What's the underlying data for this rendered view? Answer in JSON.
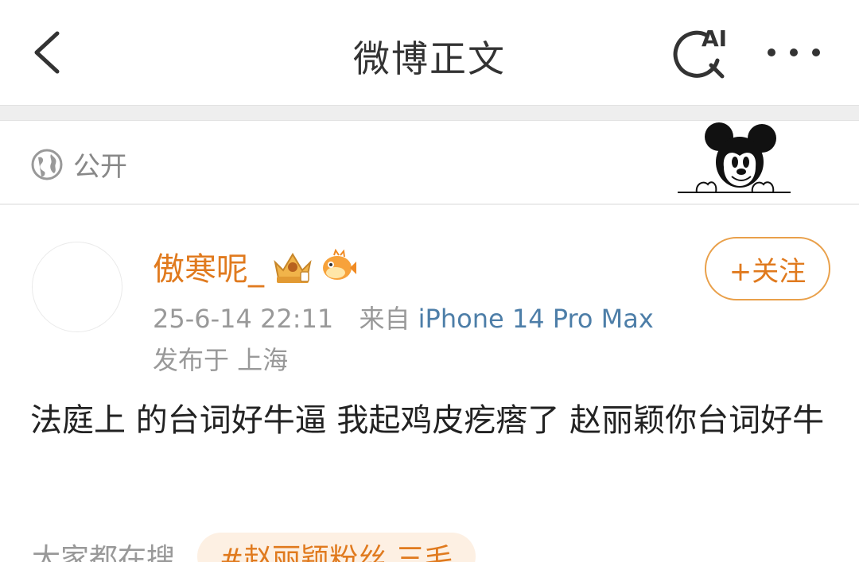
{
  "header": {
    "title": "微博正文",
    "back_icon": "chevron-left-icon",
    "ai_search_icon": "ai-search-icon",
    "ai_label": "AI",
    "more_icon": "more-dots-icon"
  },
  "visibility": {
    "icon": "globe-icon",
    "label": "公开",
    "decoration": "mickey-mouse-sticker"
  },
  "post": {
    "author": "傲寒呢_",
    "badges": [
      "crown-badge-icon",
      "pufferfish-badge-icon"
    ],
    "follow_label": "+关注",
    "time": "25-6-14 22:11",
    "from_label": "来自",
    "device": "iPhone 14 Pro Max",
    "location": "发布于 上海",
    "text": "法庭上 的台词好牛逼 我起鸡皮疙瘩了 赵丽颖你台词好牛"
  },
  "trending": {
    "label": "大家都在搜",
    "tag": "#赵丽颖粉丝 三毛"
  },
  "colors": {
    "accent": "#e07a1e",
    "link": "#4d7ea8",
    "muted": "#999999"
  }
}
